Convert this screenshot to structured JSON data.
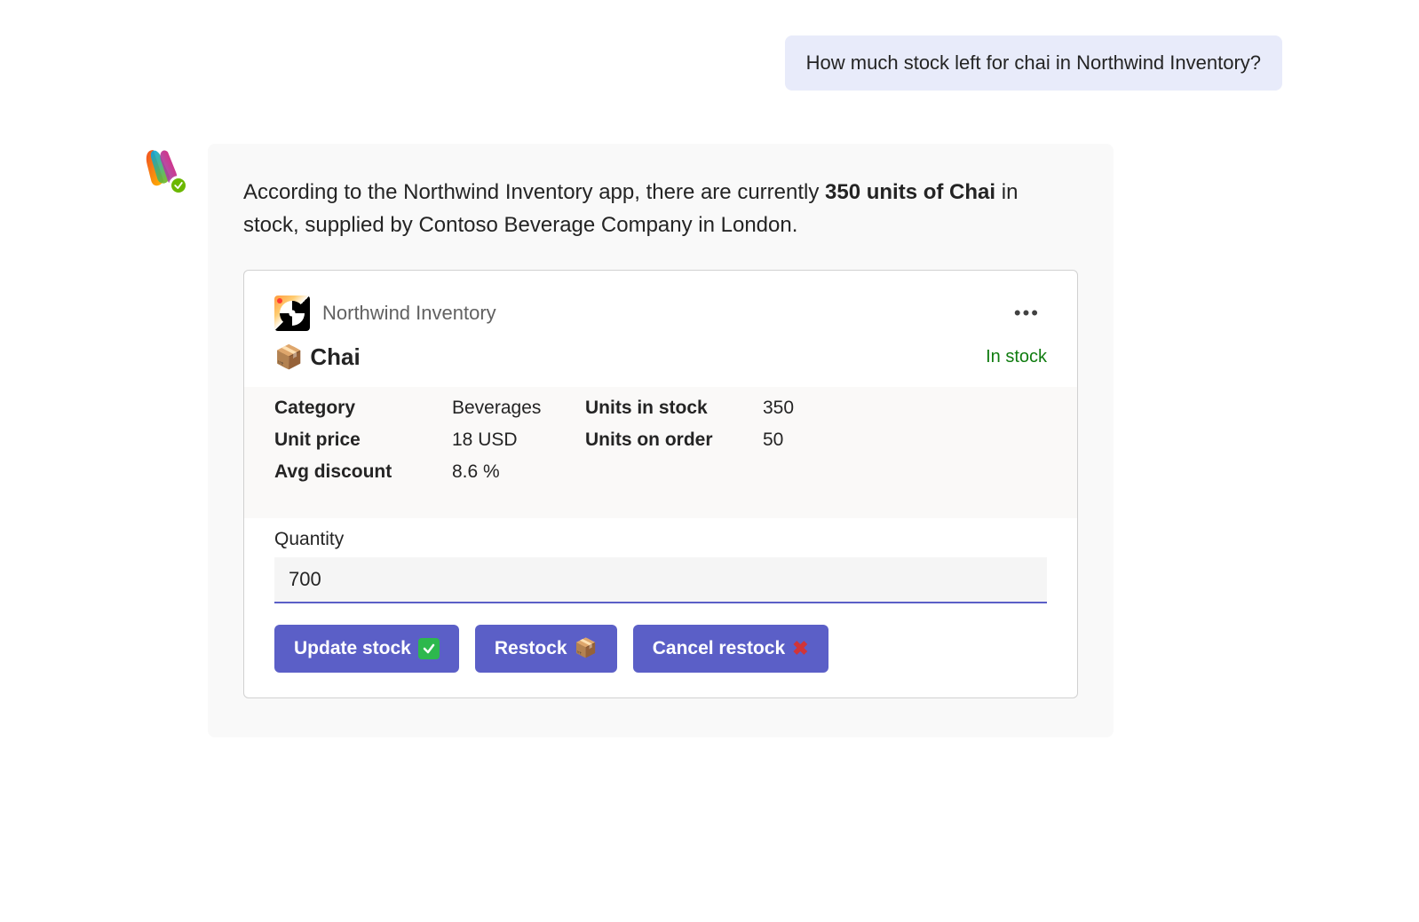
{
  "user_message": "How much stock left for chai in Northwind Inventory?",
  "assistant": {
    "text_prefix": "According to the Northwind Inventory app, there are currently ",
    "text_bold": "350 units of Chai",
    "text_suffix": " in stock, supplied by Contoso Beverage Company in London."
  },
  "card": {
    "app_name": "Northwind Inventory",
    "product_icon": "📦",
    "product_name": "Chai",
    "status_label": "In stock",
    "facts": {
      "category_label": "Category",
      "category_value": "Beverages",
      "units_in_stock_label": "Units in stock",
      "units_in_stock_value": "350",
      "unit_price_label": "Unit price",
      "unit_price_value": "18 USD",
      "units_on_order_label": "Units on order",
      "units_on_order_value": "50",
      "avg_discount_label": "Avg discount",
      "avg_discount_value": "8.6 %"
    },
    "quantity_label": "Quantity",
    "quantity_value": "700",
    "buttons": {
      "update": "Update stock",
      "restock": "Restock",
      "cancel": "Cancel restock"
    }
  }
}
